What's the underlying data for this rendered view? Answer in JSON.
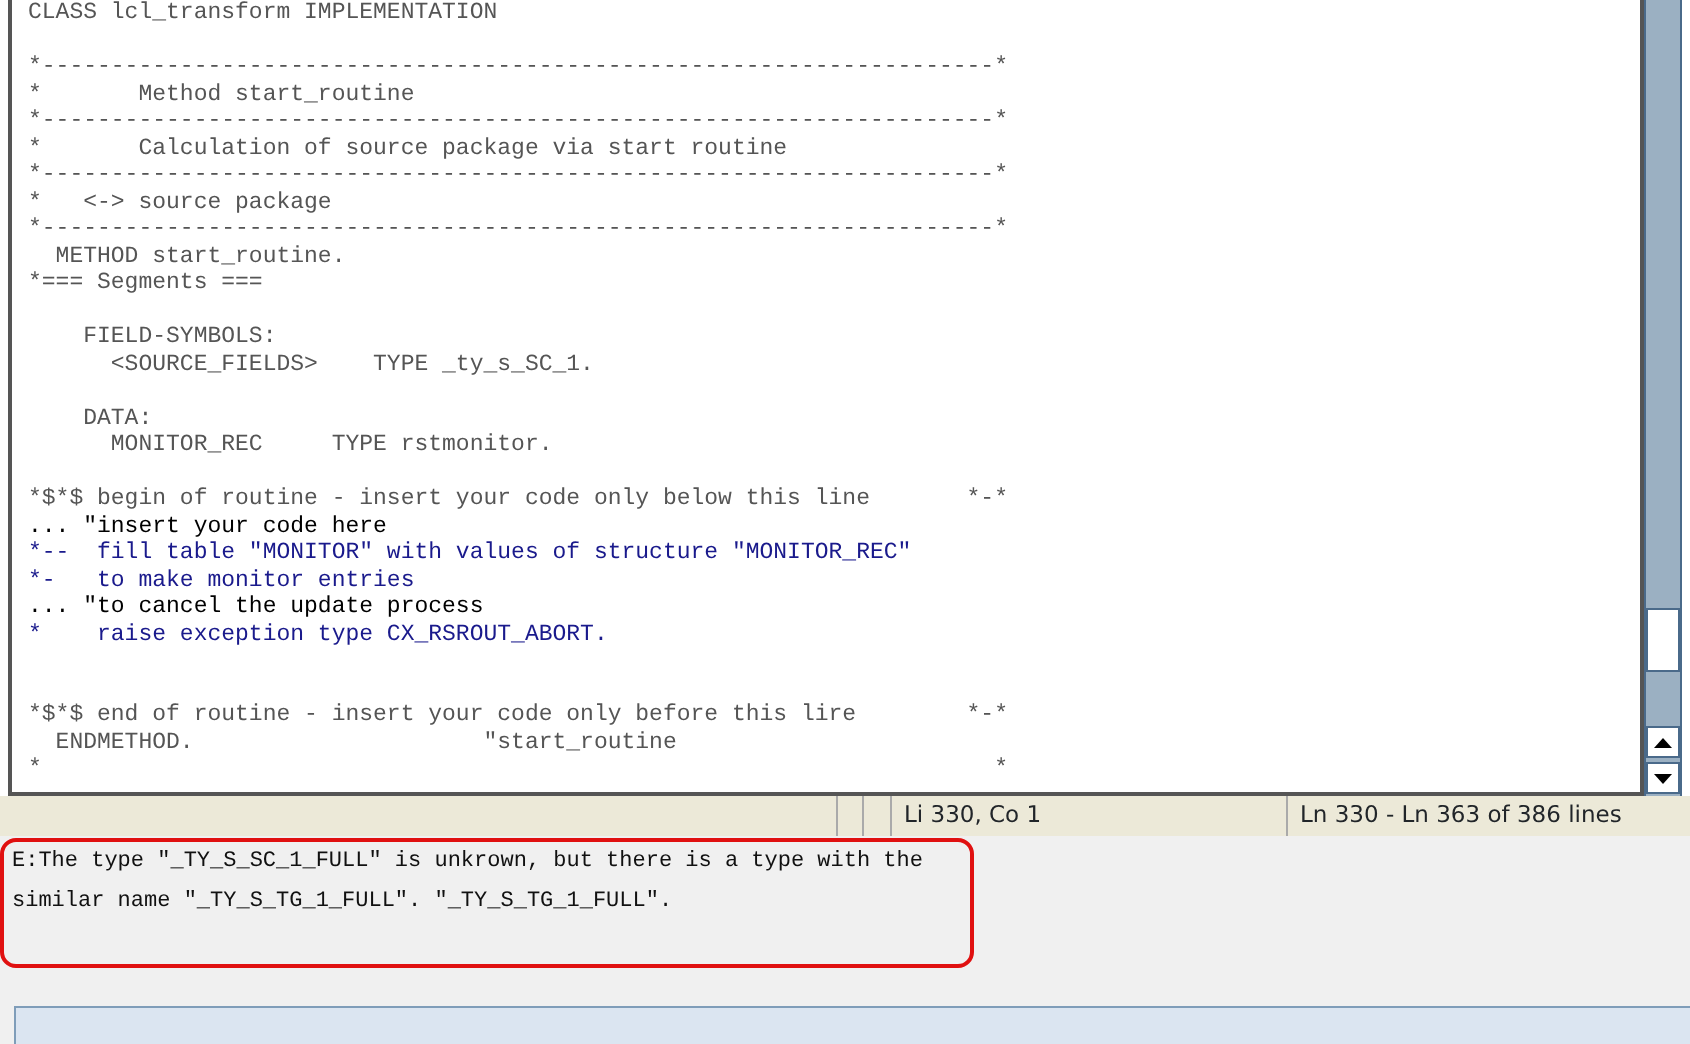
{
  "editor": {
    "lines": [
      {
        "kind": "code",
        "text": "CLASS lcl_transform IMPLEMENTATION"
      },
      {
        "kind": "code"
      },
      {
        "kind": "code",
        "text": "*---------------------------------------------------------------------*"
      },
      {
        "kind": "code",
        "text": "*       Method start_routine"
      },
      {
        "kind": "code",
        "text": "*---------------------------------------------------------------------*"
      },
      {
        "kind": "code",
        "text": "*       Calculation of source package via start routine"
      },
      {
        "kind": "code",
        "text": "*---------------------------------------------------------------------*"
      },
      {
        "kind": "code",
        "text": "*   <-> source package"
      },
      {
        "kind": "code",
        "text": "*---------------------------------------------------------------------*"
      },
      {
        "kind": "code",
        "text": "  METHOD start_routine."
      },
      {
        "kind": "code",
        "text": "*=== Segments ==="
      },
      {
        "kind": "code"
      },
      {
        "kind": "code",
        "text": "    FIELD-SYMBOLS:"
      },
      {
        "kind": "code",
        "text": "      <SOURCE_FIELDS>    TYPE _ty_s_SC_1."
      },
      {
        "kind": "code"
      },
      {
        "kind": "code",
        "text": "    DATA:"
      },
      {
        "kind": "code",
        "text": "      MONITOR_REC     TYPE rstmonitor."
      },
      {
        "kind": "code"
      },
      {
        "kind": "code",
        "text": "*$*$ begin of routine - insert your code only below this line       *-*"
      },
      {
        "kind": "editable",
        "text": "... \"insert your code here"
      },
      {
        "kind": "hint",
        "text": "*--  fill table \"MONITOR\" with values of structure \"MONITOR_REC\""
      },
      {
        "kind": "hint",
        "text": "*-   to make monitor entries"
      },
      {
        "kind": "editable",
        "text": "... \"to cancel the update process"
      },
      {
        "kind": "hint",
        "text": "*    raise exception type CX_RSROUT_ABORT."
      },
      {
        "kind": "code"
      },
      {
        "kind": "code"
      },
      {
        "kind": "code",
        "text": "*$*$ end of routine - insert your code only before this lire        *-*"
      },
      {
        "kind": "code",
        "text": "  ENDMETHOD.                     \"start_routine"
      },
      {
        "kind": "code",
        "text": "*                                                                     *"
      }
    ]
  },
  "status_bar": {
    "cursor": "Li 330, Co 1",
    "range": "Ln 330 - Ln 363 of 386 lines"
  },
  "message": "E:The type \"_TY_S_SC_1_FULL\" is unkrown, but there is a type with the similar name \"_TY_S_TG_1_FULL\". \"_TY_S_TG_1_FULL\"."
}
